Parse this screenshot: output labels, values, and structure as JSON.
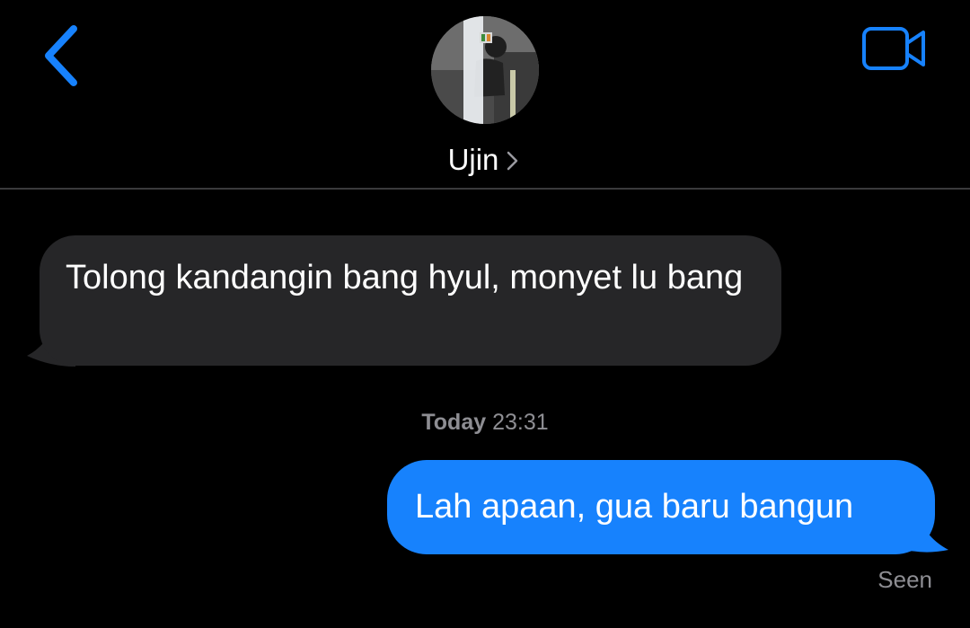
{
  "header": {
    "back_icon": "chevron-left-icon",
    "video_icon": "video-camera-icon",
    "contact_name": "Ujin",
    "contact_chevron_icon": "chevron-right-icon",
    "accent_color": "#1782fd"
  },
  "messages": [
    {
      "direction": "incoming",
      "text": "Tolong kandangin bang hyul, monyet lu bang",
      "bubble_color": "#262628"
    },
    {
      "direction": "outgoing",
      "text": "Lah apaan, gua baru bangun",
      "bubble_color": "#1782fd"
    }
  ],
  "timestamp": {
    "day": "Today",
    "time": "23:31"
  },
  "status": {
    "read_receipt": "Seen"
  }
}
